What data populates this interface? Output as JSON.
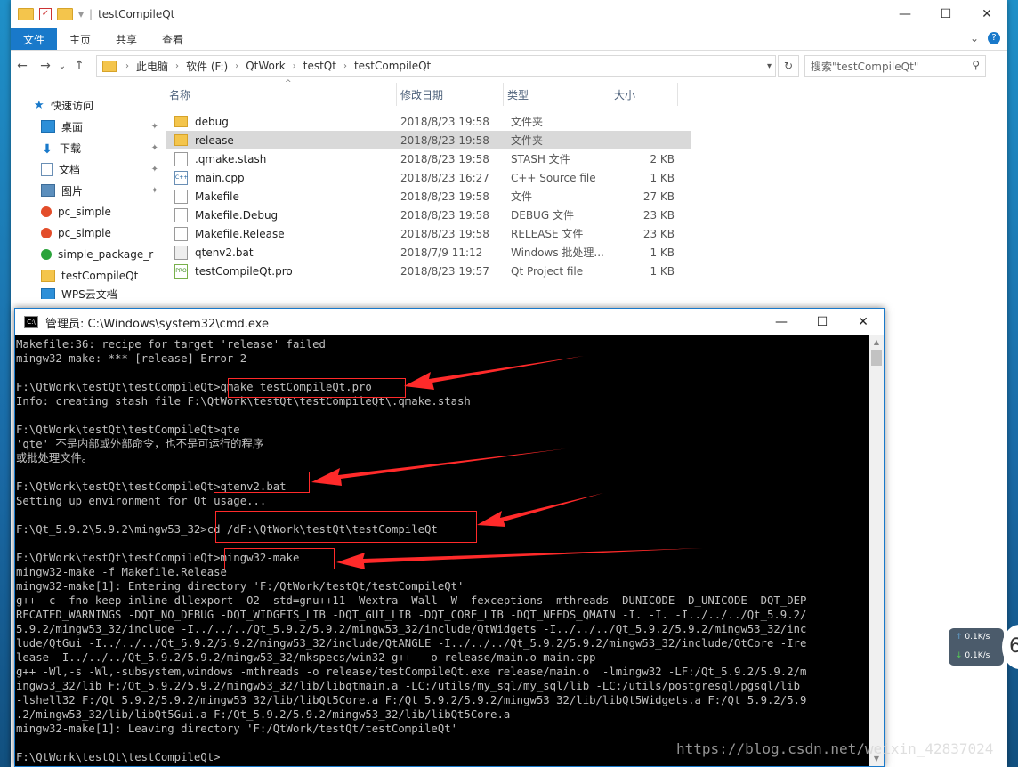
{
  "explorer": {
    "title": "testCompileQt",
    "window_controls": {
      "minimize": "—",
      "maximize": "☐",
      "close": "✕"
    },
    "ribbon": {
      "tabs": [
        {
          "label": "文件"
        },
        {
          "label": "主页"
        },
        {
          "label": "共享"
        },
        {
          "label": "查看"
        }
      ],
      "expand_glyph": "⌄",
      "help_glyph": "?"
    },
    "nav_buttons": {
      "back": "←",
      "forward": "→",
      "recent": "⌄",
      "up": "↑"
    },
    "address": {
      "crumbs": [
        "此电脑",
        "软件 (F:)",
        "QtWork",
        "testQt",
        "testCompileQt"
      ],
      "separator": "›"
    },
    "refresh_glyph": "↻",
    "search": {
      "placeholder": "搜索\"testCompileQt\"",
      "icon_glyph": "⚲"
    },
    "nav_pane": {
      "quick_access": "快速访问",
      "items": [
        {
          "label": "桌面",
          "icon": "desktop-icon",
          "pinned": true
        },
        {
          "label": "下载",
          "icon": "download-icon",
          "pinned": true
        },
        {
          "label": "文档",
          "icon": "document-icon",
          "pinned": true
        },
        {
          "label": "图片",
          "icon": "picture-icon",
          "pinned": true
        },
        {
          "label": "pc_simple",
          "icon": "pc-icon",
          "pinned": false
        },
        {
          "label": "pc_simple",
          "icon": "pc-icon",
          "pinned": false
        },
        {
          "label": "simple_package_r",
          "icon": "green-check-icon",
          "pinned": false
        },
        {
          "label": "testCompileQt",
          "icon": "folder-icon",
          "pinned": false
        }
      ],
      "partial_item": "WPS云文档",
      "pin_glyph": "📌"
    },
    "columns": {
      "name": "名称",
      "date": "修改日期",
      "type": "类型",
      "size": "大小"
    },
    "files": [
      {
        "name": "debug",
        "date": "2018/8/23 19:58",
        "type": "文件夹",
        "size": "",
        "icon": "folder"
      },
      {
        "name": "release",
        "date": "2018/8/23 19:58",
        "type": "文件夹",
        "size": "",
        "icon": "folder",
        "selected": true
      },
      {
        "name": ".qmake.stash",
        "date": "2018/8/23 19:58",
        "type": "STASH 文件",
        "size": "2 KB",
        "icon": "file"
      },
      {
        "name": "main.cpp",
        "date": "2018/8/23 16:27",
        "type": "C++ Source file",
        "size": "1 KB",
        "icon": "cpp"
      },
      {
        "name": "Makefile",
        "date": "2018/8/23 19:58",
        "type": "文件",
        "size": "27 KB",
        "icon": "file"
      },
      {
        "name": "Makefile.Debug",
        "date": "2018/8/23 19:58",
        "type": "DEBUG 文件",
        "size": "23 KB",
        "icon": "file"
      },
      {
        "name": "Makefile.Release",
        "date": "2018/8/23 19:58",
        "type": "RELEASE 文件",
        "size": "23 KB",
        "icon": "file"
      },
      {
        "name": "qtenv2.bat",
        "date": "2018/7/9 11:12",
        "type": "Windows 批处理...",
        "size": "1 KB",
        "icon": "bat"
      },
      {
        "name": "testCompileQt.pro",
        "date": "2018/8/23 19:57",
        "type": "Qt Project file",
        "size": "1 KB",
        "icon": "pro"
      }
    ]
  },
  "cmd": {
    "title": "管理员: C:\\Windows\\system32\\cmd.exe",
    "window_controls": {
      "minimize": "—",
      "maximize": "☐",
      "close": "✕"
    },
    "scroll_up_glyph": "▲",
    "scroll_down_glyph": "▼",
    "lines": [
      "Makefile:36: recipe for target 'release' failed",
      "mingw32-make: *** [release] Error 2",
      "",
      "F:\\QtWork\\testQt\\testCompileQt>qmake testCompileQt.pro",
      "Info: creating stash file F:\\QtWork\\testQt\\testCompileQt\\.qmake.stash",
      "",
      "F:\\QtWork\\testQt\\testCompileQt>qte",
      "'qte' 不是内部或外部命令，也不是可运行的程序",
      "或批处理文件。",
      "",
      "F:\\QtWork\\testQt\\testCompileQt>qtenv2.bat",
      "Setting up environment for Qt usage...",
      "",
      "F:\\Qt_5.9.2\\5.9.2\\mingw53_32>cd /dF:\\QtWork\\testQt\\testCompileQt",
      "",
      "F:\\QtWork\\testQt\\testCompileQt>mingw32-make",
      "mingw32-make -f Makefile.Release",
      "mingw32-make[1]: Entering directory 'F:/QtWork/testQt/testCompileQt'",
      "g++ -c -fno-keep-inline-dllexport -O2 -std=gnu++11 -Wextra -Wall -W -fexceptions -mthreads -DUNICODE -D_UNICODE -DQT_DEP",
      "RECATED_WARNINGS -DQT_NO_DEBUG -DQT_WIDGETS_LIB -DQT_GUI_LIB -DQT_CORE_LIB -DQT_NEEDS_QMAIN -I. -I. -I../../../Qt_5.9.2/",
      "5.9.2/mingw53_32/include -I../../../Qt_5.9.2/5.9.2/mingw53_32/include/QtWidgets -I../../../Qt_5.9.2/5.9.2/mingw53_32/inc",
      "lude/QtGui -I../../../Qt_5.9.2/5.9.2/mingw53_32/include/QtANGLE -I../../../Qt_5.9.2/5.9.2/mingw53_32/include/QtCore -Ire",
      "lease -I../../../Qt_5.9.2/5.9.2/mingw53_32/mkspecs/win32-g++  -o release/main.o main.cpp",
      "g++ -Wl,-s -Wl,-subsystem,windows -mthreads -o release/testCompileQt.exe release/main.o  -lmingw32 -LF:/Qt_5.9.2/5.9.2/m",
      "ingw53_32/lib F:/Qt_5.9.2/5.9.2/mingw53_32/lib/libqtmain.a -LC:/utils/my_sql/my_sql/lib -LC:/utils/postgresql/pgsql/lib",
      "-lshell32 F:/Qt_5.9.2/5.9.2/mingw53_32/lib/libQt5Core.a F:/Qt_5.9.2/5.9.2/mingw53_32/lib/libQt5Widgets.a F:/Qt_5.9.2/5.9",
      ".2/mingw53_32/lib/libQt5Gui.a F:/Qt_5.9.2/5.9.2/mingw53_32/lib/libQt5Core.a",
      "mingw32-make[1]: Leaving directory 'F:/QtWork/testQt/testCompileQt'",
      "",
      "F:\\QtWork\\testQt\\testCompileQt>"
    ]
  },
  "net_widget": {
    "up": "0.1K/s",
    "down": "0.1K/s",
    "up_glyph": "↑",
    "down_glyph": "↓"
  },
  "partial_circle_text": "6",
  "watermark": "https://blog.csdn.net/weixin_42837024",
  "colors": {
    "accent": "#1979ca",
    "highlight": "#ff2a2a",
    "console_bg": "#000000",
    "console_fg": "#c0c0c0"
  }
}
